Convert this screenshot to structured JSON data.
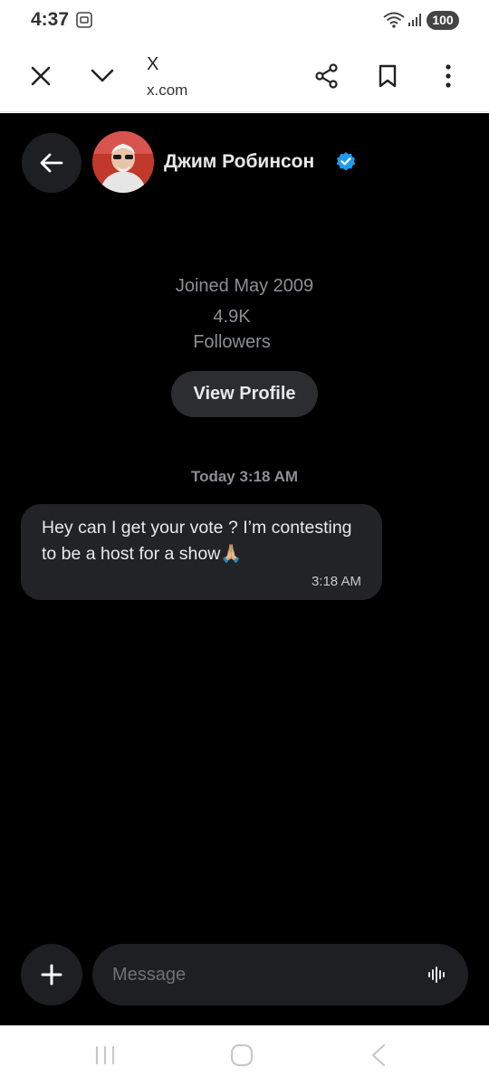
{
  "status_bar": {
    "time": "4:37",
    "battery": "100"
  },
  "browser": {
    "title": "X",
    "url": "x.com",
    "icons": [
      "close-icon",
      "chevron-down-icon",
      "share-icon",
      "bookmark-icon",
      "more-vertical-icon"
    ]
  },
  "conversation": {
    "name": "Джим Робинсон",
    "verified": true,
    "joined": "Joined May 2009",
    "followers_count": "4.9K",
    "followers_label": "Followers",
    "view_profile_label": "View Profile",
    "date_separator": "Today 3:18 AM"
  },
  "messages": [
    {
      "text": "Hey can I get your vote ? I’m contesting to be a host for a show🙏🏼",
      "time": "3:18 AM"
    }
  ],
  "composer": {
    "placeholder": "Message"
  },
  "colors": {
    "app_background": "#000000",
    "bubble": "#212327",
    "verified_badge": "#1d9bf0",
    "muted_text": "#8b8f95"
  }
}
